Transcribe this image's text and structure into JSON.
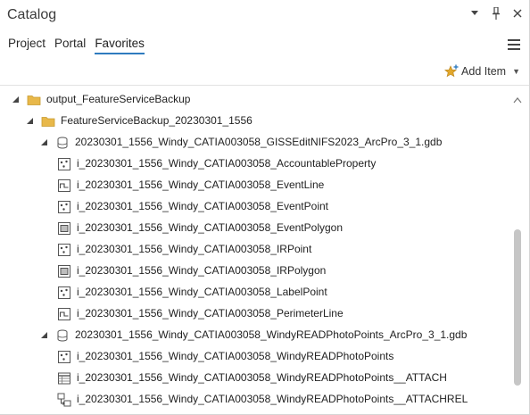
{
  "panel": {
    "title": "Catalog",
    "tabs": [
      {
        "label": "Project",
        "active": false
      },
      {
        "label": "Portal",
        "active": false
      },
      {
        "label": "Favorites",
        "active": true
      }
    ],
    "add_item_label": "Add Item",
    "accent_color": "#2f7bbf",
    "folder_color": "#e8b84a"
  },
  "tree": [
    {
      "label": "output_FeatureServiceBackup",
      "icon": "folder-icon",
      "expanded": true,
      "depth": 0
    },
    {
      "label": "FeatureServiceBackup_20230301_1556",
      "icon": "folder-icon",
      "expanded": true,
      "depth": 1
    },
    {
      "label": "20230301_1556_Windy_CATIA003058_GISSEditNIFS2023_ArcPro_3_1.gdb",
      "icon": "geodatabase-icon",
      "expanded": true,
      "depth": 2
    },
    {
      "label": "i_20230301_1556_Windy_CATIA003058_AccountableProperty",
      "icon": "point-feature-class-icon",
      "depth": 3
    },
    {
      "label": "i_20230301_1556_Windy_CATIA003058_EventLine",
      "icon": "line-feature-class-icon",
      "depth": 3
    },
    {
      "label": "i_20230301_1556_Windy_CATIA003058_EventPoint",
      "icon": "point-feature-class-icon",
      "depth": 3
    },
    {
      "label": "i_20230301_1556_Windy_CATIA003058_EventPolygon",
      "icon": "polygon-feature-class-icon",
      "depth": 3
    },
    {
      "label": "i_20230301_1556_Windy_CATIA003058_IRPoint",
      "icon": "point-feature-class-icon",
      "depth": 3
    },
    {
      "label": "i_20230301_1556_Windy_CATIA003058_IRPolygon",
      "icon": "polygon-feature-class-icon",
      "depth": 3
    },
    {
      "label": "i_20230301_1556_Windy_CATIA003058_LabelPoint",
      "icon": "point-feature-class-icon",
      "depth": 3
    },
    {
      "label": "i_20230301_1556_Windy_CATIA003058_PerimeterLine",
      "icon": "line-feature-class-icon",
      "depth": 3
    },
    {
      "label": "20230301_1556_Windy_CATIA003058_WindyREADPhotoPoints_ArcPro_3_1.gdb",
      "icon": "geodatabase-icon",
      "expanded": true,
      "depth": 2
    },
    {
      "label": "i_20230301_1556_Windy_CATIA003058_WindyREADPhotoPoints",
      "icon": "point-feature-class-icon",
      "depth": 3
    },
    {
      "label": "i_20230301_1556_Windy_CATIA003058_WindyREADPhotoPoints__ATTACH",
      "icon": "table-icon",
      "depth": 3
    },
    {
      "label": "i_20230301_1556_Windy_CATIA003058_WindyREADPhotoPoints__ATTACHREL",
      "icon": "relationship-class-icon",
      "depth": 3
    }
  ]
}
